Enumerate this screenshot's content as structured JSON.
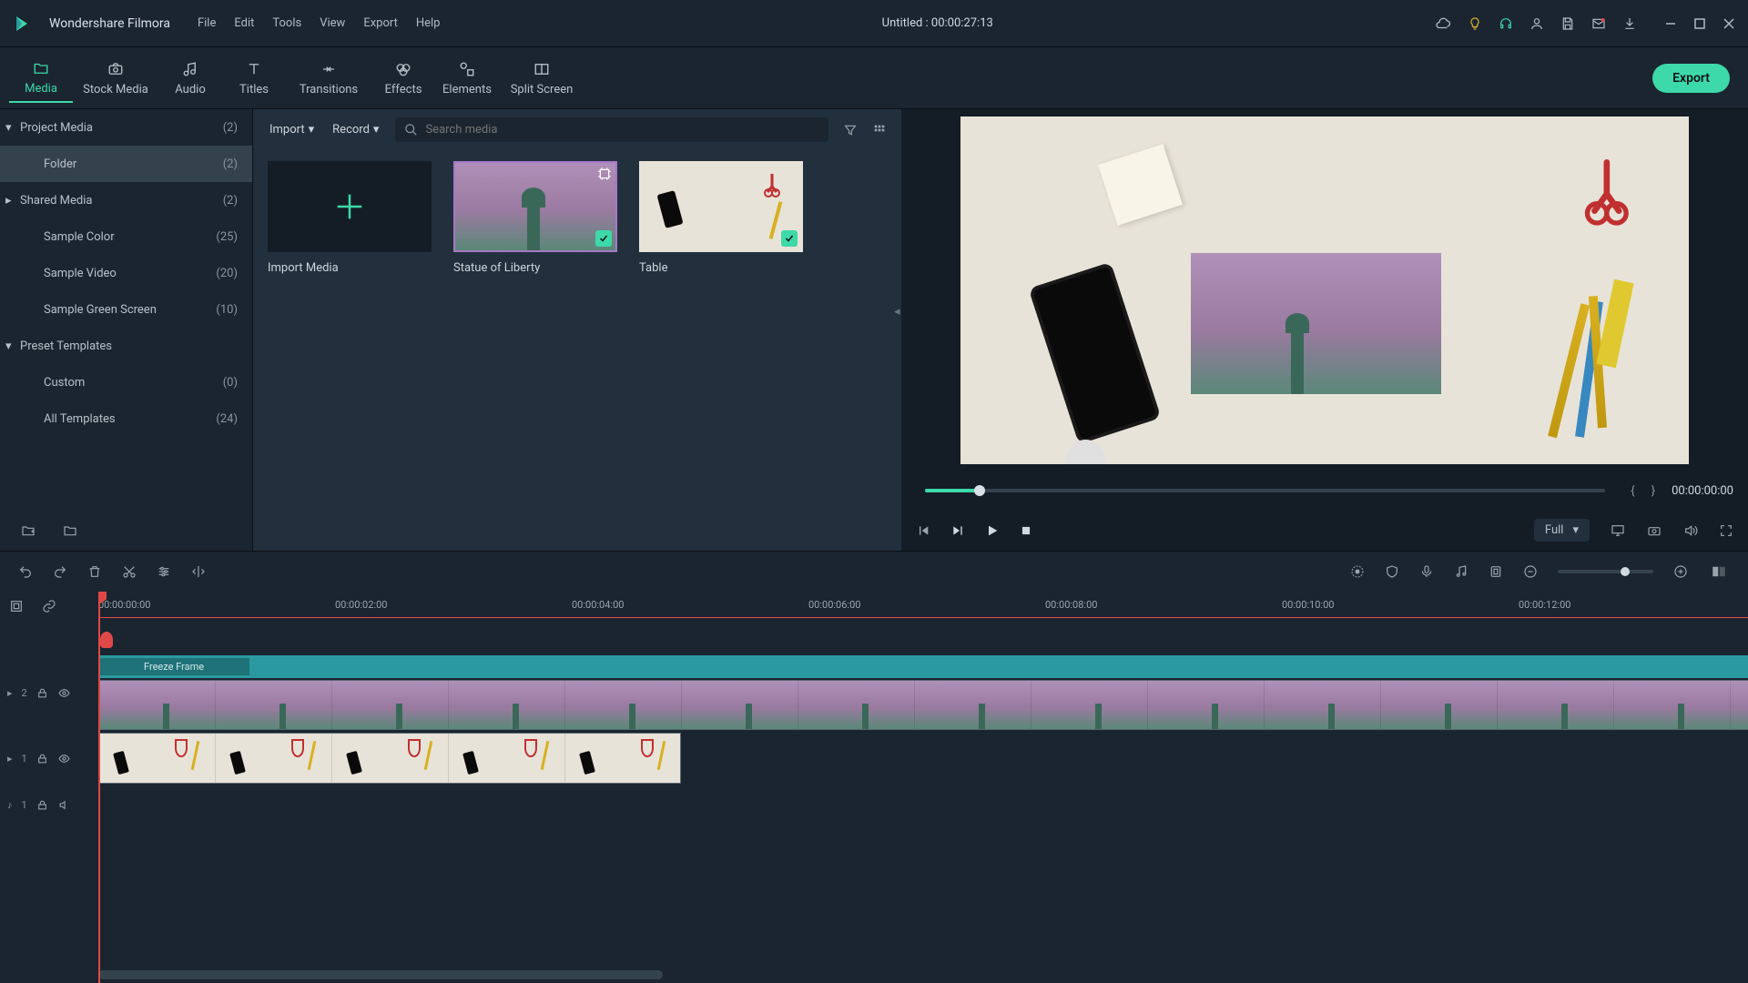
{
  "app": {
    "name": "Wondershare Filmora",
    "project_title": "Untitled : 00:00:27:13"
  },
  "menu": [
    "File",
    "Edit",
    "Tools",
    "View",
    "Export",
    "Help"
  ],
  "tabs": [
    {
      "label": "Media",
      "active": true
    },
    {
      "label": "Stock Media"
    },
    {
      "label": "Audio"
    },
    {
      "label": "Titles"
    },
    {
      "label": "Transitions"
    },
    {
      "label": "Effects"
    },
    {
      "label": "Elements"
    },
    {
      "label": "Split Screen"
    }
  ],
  "export_label": "Export",
  "sidebar": [
    {
      "label": "Project Media",
      "count": "(2)",
      "arrow": "down"
    },
    {
      "label": "Folder",
      "count": "(2)",
      "child": true,
      "selected": true
    },
    {
      "label": "Shared Media",
      "count": "(2)",
      "arrow": "right"
    },
    {
      "label": "Sample Color",
      "count": "(25)",
      "child": true
    },
    {
      "label": "Sample Video",
      "count": "(20)",
      "child": true
    },
    {
      "label": "Sample Green Screen",
      "count": "(10)",
      "child": true
    },
    {
      "label": "Preset Templates",
      "count": "",
      "arrow": "down"
    },
    {
      "label": "Custom",
      "count": "(0)",
      "child": true
    },
    {
      "label": "All Templates",
      "count": "(24)",
      "child": true
    }
  ],
  "mid": {
    "import": "Import",
    "record": "Record",
    "search_ph": "Search media",
    "tiles": [
      {
        "label": "Import Media",
        "type": "add"
      },
      {
        "label": "Statue of Liberty",
        "type": "statue",
        "selected": true,
        "checked": true
      },
      {
        "label": "Table",
        "type": "table",
        "checked": true
      }
    ]
  },
  "preview": {
    "time": "00:00:00:00",
    "brace_l": "{",
    "brace_r": "}",
    "quality": "Full"
  },
  "timeline": {
    "ticks": [
      "00:00:00:00",
      "00:00:02:00",
      "00:00:04:00",
      "00:00:06:00",
      "00:00:08:00",
      "00:00:10:00",
      "00:00:12:00"
    ],
    "freeze": "Freeze Frame",
    "clip1": "Statue of Liberty",
    "clip2": "Table",
    "tracks": [
      {
        "id": "2",
        "icon": "video"
      },
      {
        "id": "1",
        "icon": "video"
      },
      {
        "id": "1",
        "icon": "audio"
      }
    ]
  }
}
